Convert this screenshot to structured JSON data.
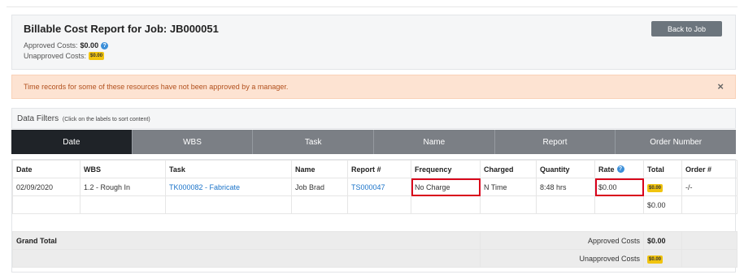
{
  "header": {
    "title": "Billable Cost Report for Job: JB000051",
    "approved_label": "Approved Costs:",
    "approved_value": "$0.00",
    "unapproved_label": "Unapproved Costs:",
    "unapproved_value": "$0.00",
    "back_label": "Back to Job"
  },
  "alert": {
    "message": "Time records for some of these resources have not been approved by a manager.",
    "close": "×"
  },
  "filters": {
    "title": "Data Filters",
    "hint": "(Click on the labels to sort content)",
    "tabs": [
      "Date",
      "WBS",
      "Task",
      "Name",
      "Report",
      "Order Number"
    ]
  },
  "table": {
    "columns": [
      "Date",
      "WBS",
      "Task",
      "Name",
      "Report #",
      "Frequency",
      "Charged",
      "Quantity",
      "Rate",
      "Total",
      "Order #"
    ],
    "row": {
      "date": "02/09/2020",
      "wbs": "1.2 - Rough In",
      "task": "TK000082 - Fabricate",
      "name": "Job Brad",
      "report": "TS000047",
      "frequency": "No Charge",
      "charged": "N Time",
      "quantity": "8:48 hrs",
      "rate": "$0.00",
      "total": "$0.00",
      "order": "-/-"
    },
    "subtotal": "$0.00",
    "grand_total_label": "Grand Total",
    "approved_costs_label": "Approved Costs",
    "approved_costs_value": "$0.00",
    "unapproved_costs_label": "Unapproved Costs",
    "unapproved_costs_value": "$0.00"
  },
  "colors": {
    "active_tab": "#1f2328",
    "tab": "#7b7f85",
    "alert_bg": "#fde3d2",
    "alert_text": "#b2501d",
    "badge": "#f1c40f",
    "link": "#1a73c9",
    "highlight": "#d9001b"
  }
}
